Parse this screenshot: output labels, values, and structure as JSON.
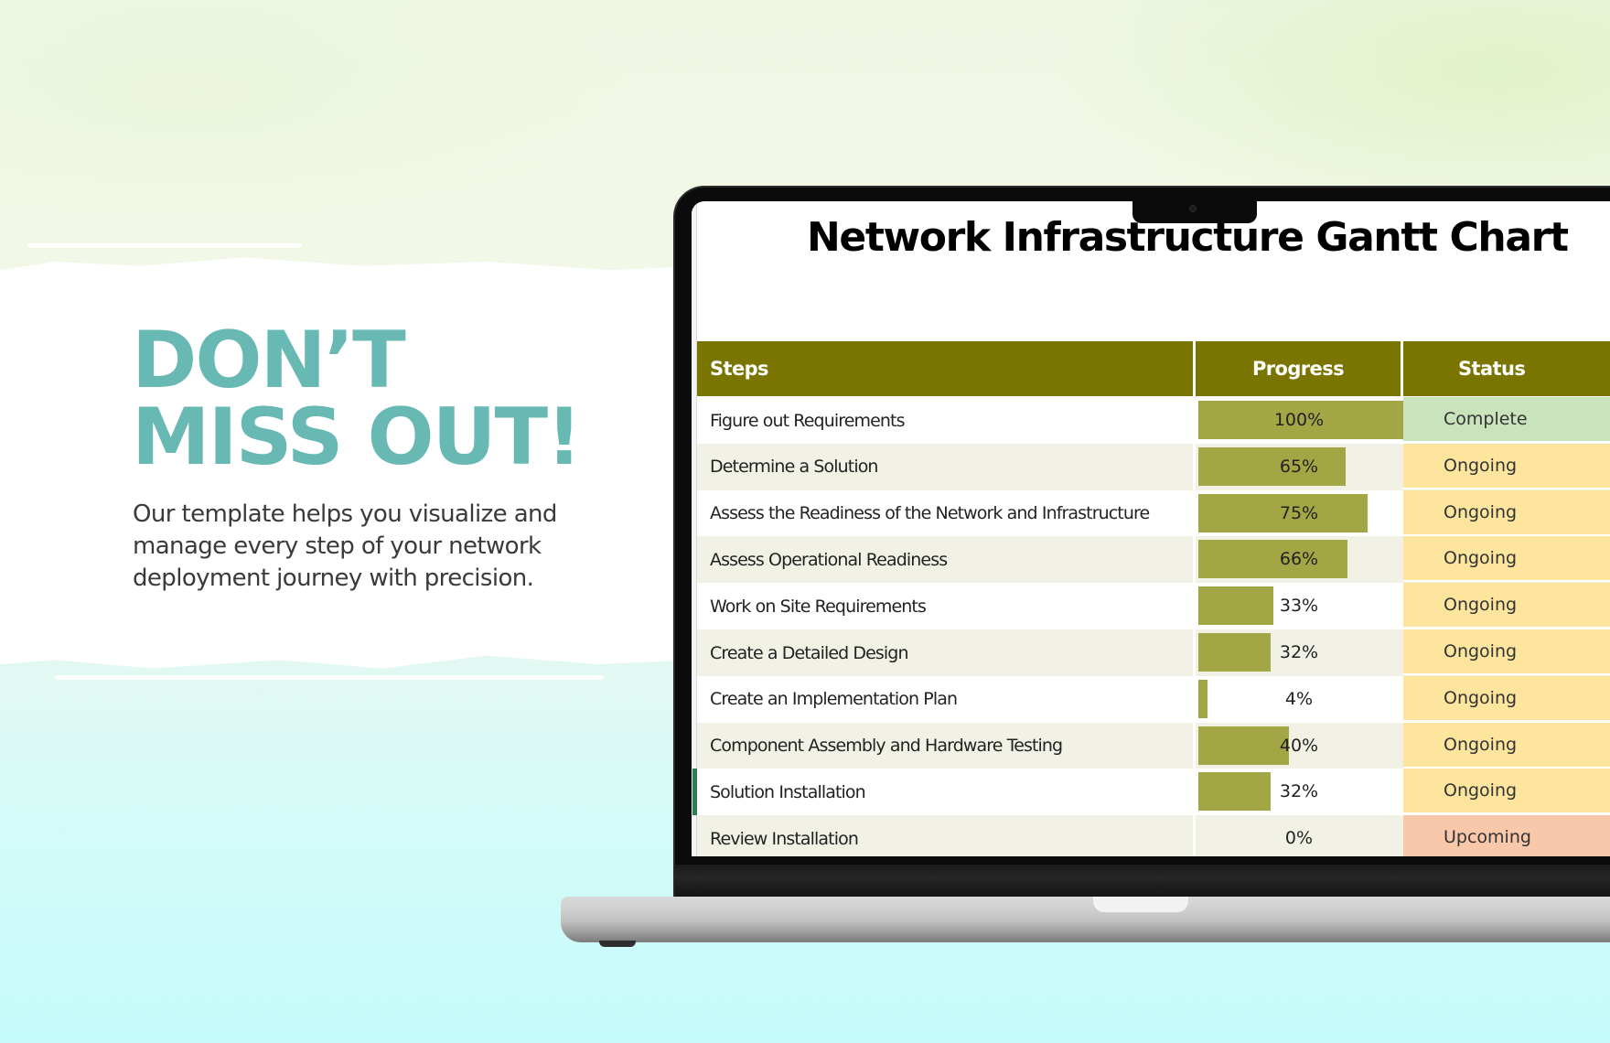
{
  "hero": {
    "title_line1": "DON’T",
    "title_line2": "MISS OUT!",
    "body_lines": [
      "Our template helps you visualize and",
      "manage every step of your network",
      "deployment journey with precision."
    ],
    "accent_color": "#68b8b3"
  },
  "sheet": {
    "title": "Network Infrastructure Gantt Chart",
    "headers": {
      "steps": "Steps",
      "progress": "Progress",
      "status": "Status"
    },
    "header_color": "#7a7400",
    "bar_color": "#a3a644",
    "status_colors": {
      "Complete": "#c9e3bd",
      "Ongoing": "#fde59e",
      "Upcoming": "#f9c7aa"
    },
    "selected_row": 8,
    "rows": [
      {
        "step": "Figure out Requirements",
        "progress": 100,
        "progress_label": "100%",
        "status": "Complete"
      },
      {
        "step": "Determine a Solution",
        "progress": 65,
        "progress_label": "65%",
        "status": "Ongoing"
      },
      {
        "step": "Assess the Readiness of the Network and Infrastructure",
        "progress": 75,
        "progress_label": "75%",
        "status": "Ongoing"
      },
      {
        "step": "Assess Operational Readiness",
        "progress": 66,
        "progress_label": "66%",
        "status": "Ongoing"
      },
      {
        "step": "Work on Site Requirements",
        "progress": 33,
        "progress_label": "33%",
        "status": "Ongoing"
      },
      {
        "step": "Create a Detailed Design",
        "progress": 32,
        "progress_label": "32%",
        "status": "Ongoing"
      },
      {
        "step": "Create an Implementation Plan",
        "progress": 4,
        "progress_label": "4%",
        "status": "Ongoing"
      },
      {
        "step": "Component Assembly and Hardware Testing",
        "progress": 40,
        "progress_label": "40%",
        "status": "Ongoing"
      },
      {
        "step": "Solution Installation",
        "progress": 32,
        "progress_label": "32%",
        "status": "Ongoing"
      },
      {
        "step": "Review Installation",
        "progress": 0,
        "progress_label": "0%",
        "status": "Upcoming"
      }
    ]
  }
}
